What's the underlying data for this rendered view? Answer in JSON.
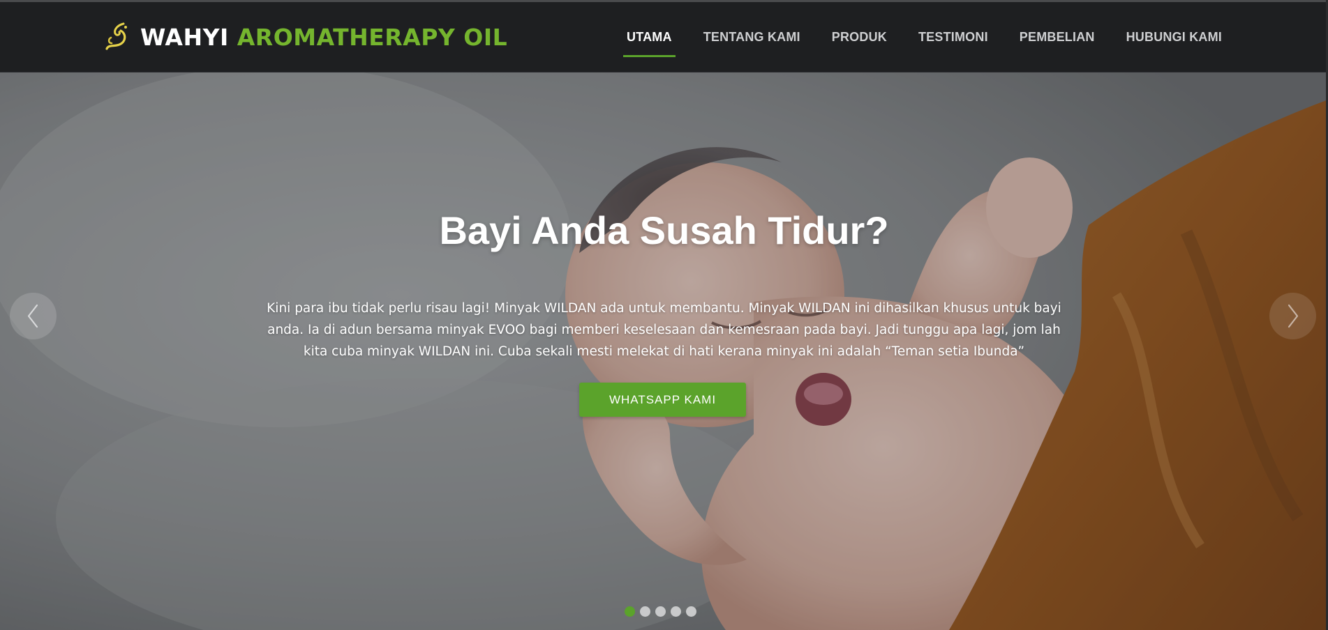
{
  "brand": {
    "name_white": "WAHYI",
    "name_green": "AROMATHERAPY OIL"
  },
  "nav": {
    "items": [
      {
        "label": "UTAMA",
        "active": true
      },
      {
        "label": "TENTANG KAMI",
        "active": false
      },
      {
        "label": "PRODUK",
        "active": false
      },
      {
        "label": "TESTIMONI",
        "active": false
      },
      {
        "label": "PEMBELIAN",
        "active": false
      },
      {
        "label": "HUBUNGI KAMI",
        "active": false
      }
    ]
  },
  "hero": {
    "title": "Bayi Anda Susah Tidur?",
    "text": "Kini para ibu tidak perlu risau lagi! Minyak WILDAN ada untuk membantu. Minyak WILDAN ini dihasilkan khusus untuk bayi anda. Ia di adun bersama minyak EVOO bagi memberi keselesaan dan kemesraan pada bayi. Jadi tunggu apa lagi, jom lah kita cuba minyak WILDAN ini. Cuba sekali mesti melekat di hati kerana minyak ini adalah “Teman setia Ibunda”",
    "cta_label": "WHATSAPP KAMI",
    "prev_icon": "chevron-left-icon",
    "next_icon": "chevron-right-icon"
  },
  "carousel": {
    "slide_count": 5,
    "active_index": 0
  },
  "colors": {
    "accent": "#5ba32b",
    "brand_green": "#75b52e",
    "navbar_bg": "#1e1f21"
  }
}
